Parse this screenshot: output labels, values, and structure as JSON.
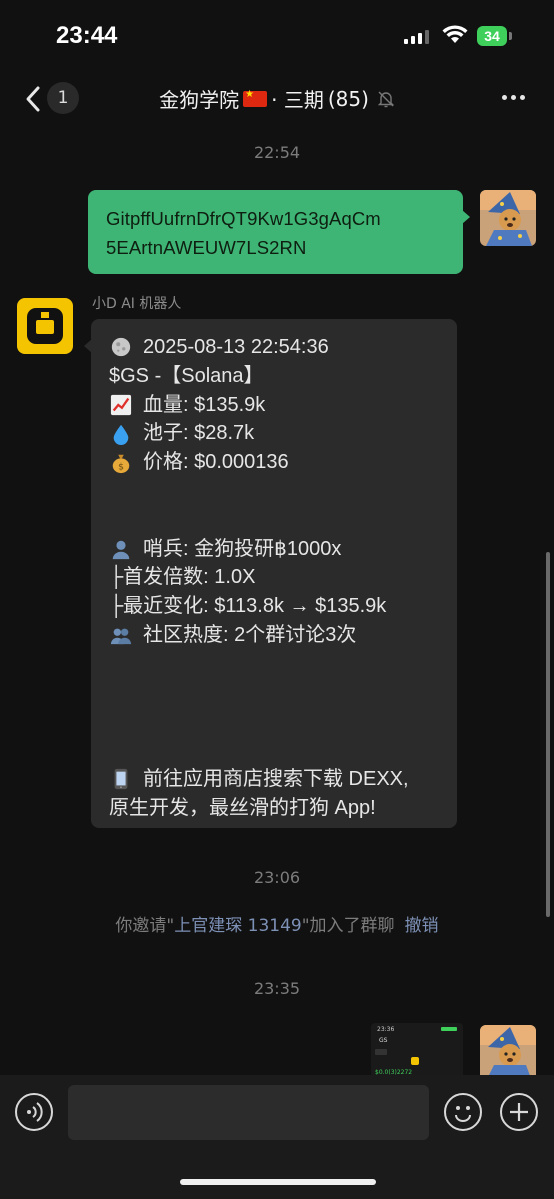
{
  "status_bar": {
    "time": "23:44",
    "battery": "34"
  },
  "nav": {
    "back_count": "1",
    "title_prefix": "金狗学院",
    "title_suffix": "· 三期",
    "member_count": "(85)"
  },
  "messages": {
    "ts1": "22:54",
    "outgoing_address_line1": "GitpffUufrnDfrQT9Kw1G3gAqCm",
    "outgoing_address_line2": "5EArtnAWEUW7LS2RN",
    "bot_name": "小D AI 机器人",
    "bot_lines": {
      "l1": "2025-08-13 22:54:36",
      "l2": "$GS -【Solana】",
      "l3": "血量: $135.9k",
      "l4": "池子: $28.7k",
      "l5": "价格: $0.000136",
      "l6": "哨兵: 金狗投研฿1000x",
      "l7": "├首发倍数: 1.0X",
      "l8": "├最近变化: $113.8k → $135.9k",
      "l9": "社区热度: 2个群讨论3次",
      "l10": "前往应用商店搜索下载 DEXX,",
      "l11": "原生开发，最丝滑的打狗 App!"
    },
    "ts2": "23:06",
    "invite_prefix": "你邀请\"",
    "invite_name": "上官建琛 13149",
    "invite_suffix": "\"加入了群聊",
    "invite_undo": "撤销",
    "ts3": "23:35",
    "image_preview": {
      "time": "23:36",
      "symbol": "GS",
      "price": "$0.0(3)2272"
    }
  },
  "colors": {
    "accent_green": "#3eb575",
    "bot_yellow": "#f5c400",
    "link_blue": "#7d90b5"
  }
}
